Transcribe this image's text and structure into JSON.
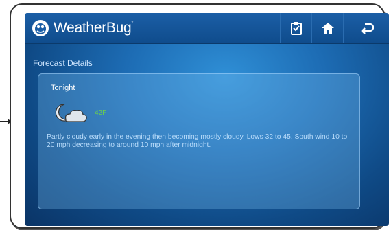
{
  "app": {
    "brand": "WeatherBug",
    "trademark": "°"
  },
  "toolbar": {
    "icons": [
      "clipboard-icon",
      "home-icon",
      "back-icon"
    ]
  },
  "main": {
    "section_title": "Forecast Details",
    "forecast": {
      "period": "Tonight",
      "condition_icon": "partly-cloudy-night-icon",
      "temperature": "42F",
      "description": "Partly cloudy early in the evening then becoming mostly cloudy. Lows 32 to 45. South wind 10 to 20 mph decreasing to around 10 mph after midnight."
    }
  },
  "colors": {
    "topbar": "#1563ad",
    "background": "#1d6cb4",
    "temperature": "#6cd14a",
    "text": "#b9dcfb"
  }
}
